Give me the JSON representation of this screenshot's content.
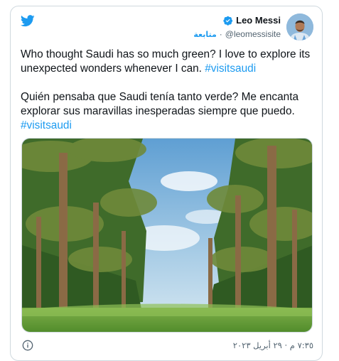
{
  "header": {
    "display_name": "Leo Messi",
    "handle": "@leomessisite",
    "separator": "·",
    "follow_label": "متابعة",
    "icons": [
      "bird-icon",
      "verified-icon"
    ]
  },
  "tweet": {
    "paragraph_1": "Who thought Saudi has so much green? I love to explore its unexpected wonders whenever I can.",
    "hashtag_1": "#visitsaudi",
    "paragraph_2": "Quién pensaba que Saudi tenía tanto verde? Me encanta explorar sus maravillas inesperadas siempre que puedo.",
    "hashtag_2": "#visitsaudi"
  },
  "footer": {
    "timestamp": "٧:٣٥ م · ٢٩ أبريل ٢٠٢٣",
    "icons": [
      "info-icon"
    ]
  },
  "colors": {
    "accent": "#1d9bf0",
    "text": "#0f1419",
    "muted": "#536471",
    "border": "#cfd9de"
  }
}
